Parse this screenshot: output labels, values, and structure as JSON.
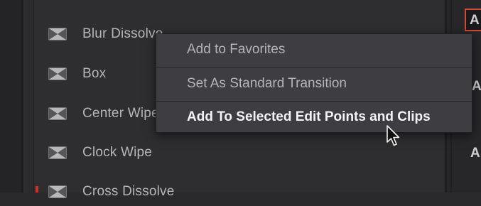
{
  "transitions": {
    "items": [
      {
        "label": "Blur Dissolve",
        "icon": "transition-icon"
      },
      {
        "label": "Box",
        "icon": "transition-icon"
      },
      {
        "label": "Center Wipe",
        "icon": "transition-icon"
      },
      {
        "label": "Clock Wipe",
        "icon": "transition-icon"
      },
      {
        "label": "Cross Dissolve",
        "icon": "transition-icon"
      }
    ]
  },
  "context_menu": {
    "items": [
      {
        "label": "Add to Favorites",
        "state": "normal"
      },
      {
        "label": "Set As Standard Transition",
        "state": "normal"
      },
      {
        "label": "Add To Selected Edit Points and Clips",
        "state": "hovered"
      }
    ]
  },
  "right_panel": {
    "letters": [
      "A",
      "A",
      "A"
    ]
  },
  "colors": {
    "accent_red": "#c8352c",
    "menu_bg": "#3e3e42",
    "panel_bg": "#2e2e31"
  }
}
